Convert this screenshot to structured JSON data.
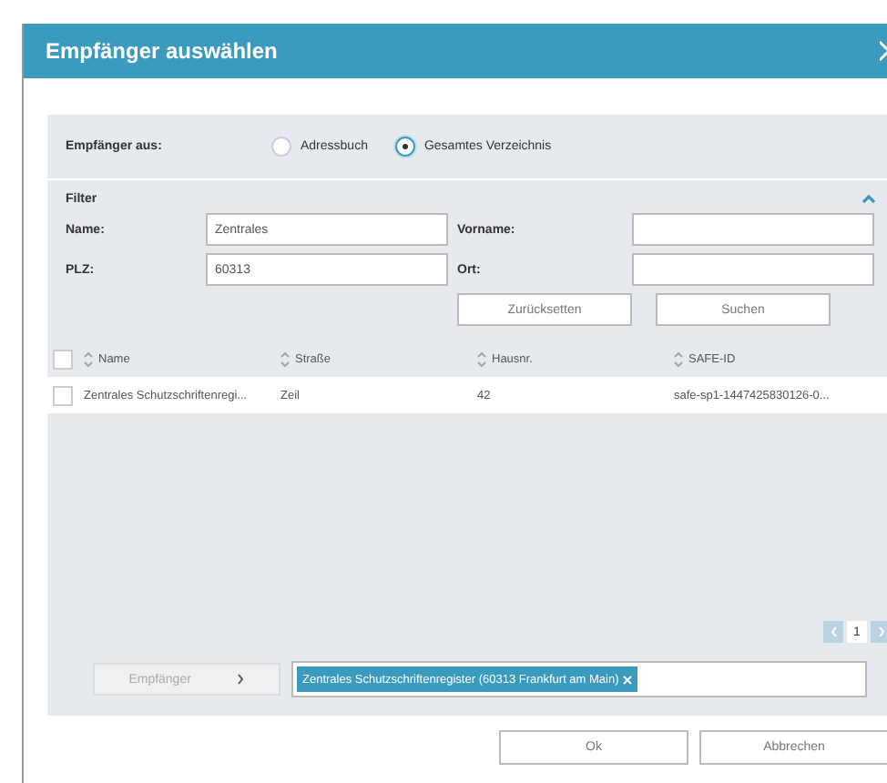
{
  "dialog": {
    "title": "Empfänger auswählen"
  },
  "source": {
    "label": "Empfänger aus:",
    "options": [
      {
        "label": "Adressbuch",
        "selected": false
      },
      {
        "label": "Gesamtes Verzeichnis",
        "selected": true
      }
    ]
  },
  "filter": {
    "title": "Filter",
    "expanded": true,
    "fields": [
      {
        "label": "Name:",
        "value": "Zentrales"
      },
      {
        "label": "Vorname:"
      },
      {
        "label": "PLZ:",
        "value": "60313"
      },
      {
        "label": "Ort:"
      }
    ],
    "buttons": [
      "Zurücksetten",
      "Suchen"
    ]
  },
  "table": {
    "all_checked": false,
    "columns": [
      "Name",
      "Straße",
      "Hausnr.",
      "SAFE-ID"
    ],
    "rows": [
      {
        "checked": false,
        "cells": [
          "Zentrales Schutzschriftenregi...",
          "Zeil",
          "42",
          "safe-sp1-1447425830126-0..."
        ]
      }
    ]
  },
  "pager": {
    "page": "1"
  },
  "recipient": {
    "button": "Empfänger",
    "chip": "Zentrales Schutzschriftenregister (60313 Frankfurt am Main)"
  },
  "footer": {
    "buttons": [
      "Ok",
      "Abbrechen"
    ]
  }
}
